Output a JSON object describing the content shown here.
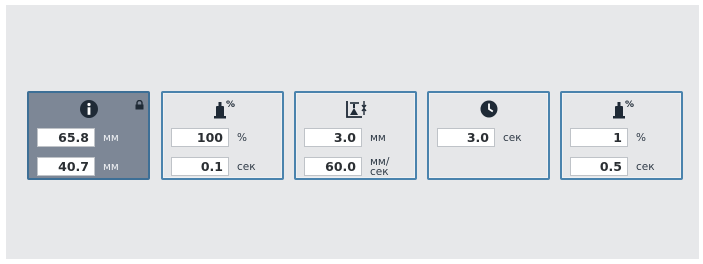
{
  "panels": [
    {
      "icon": "info-icon",
      "active": true,
      "locked": true,
      "fields": [
        {
          "value": "65.8",
          "unit": "мм"
        },
        {
          "value": "40.7",
          "unit": "мм"
        }
      ]
    },
    {
      "icon": "dispense-percent-icon",
      "icon_text": "%",
      "fields": [
        {
          "value": "100",
          "unit": "%"
        },
        {
          "value": "0.1",
          "unit": "сек"
        }
      ]
    },
    {
      "icon": "lift-speed-icon",
      "fields": [
        {
          "value": "3.0",
          "unit": "мм"
        },
        {
          "value": "60.0",
          "unit": "мм/ сек"
        }
      ]
    },
    {
      "icon": "clock-icon",
      "fields": [
        {
          "value": "3.0",
          "unit": "сек"
        }
      ]
    },
    {
      "icon": "dispense-percent-icon",
      "icon_text": "%",
      "fields": [
        {
          "value": "1",
          "unit": "%"
        },
        {
          "value": "0.5",
          "unit": "сек"
        }
      ]
    }
  ],
  "colors": {
    "background": "#e7e8ea",
    "panel_border": "#4a83ad",
    "active_panel": "#7d8796",
    "icon": "#2f3a46"
  }
}
